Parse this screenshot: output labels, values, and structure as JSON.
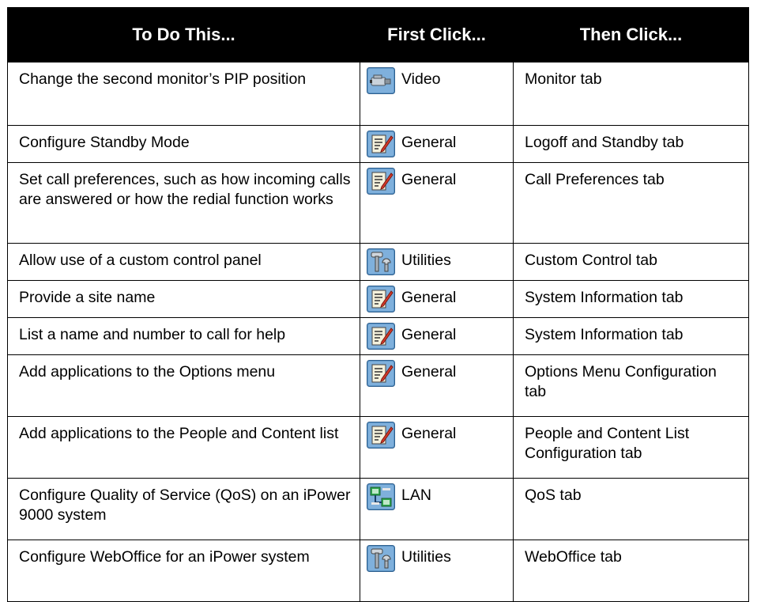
{
  "header": {
    "col1": "To Do This...",
    "col2": "First Click...",
    "col3": "Then Click..."
  },
  "rows": [
    {
      "task": "Change the second monitor’s PIP position",
      "first_icon": "video-camera-icon",
      "first_label": "Video",
      "then": "Monitor tab"
    },
    {
      "task": "Configure Standby Mode",
      "first_icon": "general-settings-icon",
      "first_label": "General",
      "then": "Logoff and Standby tab"
    },
    {
      "task": "Set call preferences, such as how incoming calls are answered or how the redial function works",
      "first_icon": "general-settings-icon",
      "first_label": "General",
      "then": "Call Preferences tab"
    },
    {
      "task": "Allow use of a custom control panel",
      "first_icon": "utilities-tools-icon",
      "first_label": "Utilities",
      "then": "Custom Control tab"
    },
    {
      "task": "Provide a site name",
      "first_icon": "general-settings-icon",
      "first_label": "General",
      "then": "System Information tab"
    },
    {
      "task": "List a name and number to call for help",
      "first_icon": "general-settings-icon",
      "first_label": "General",
      "then": "System Information tab"
    },
    {
      "task": "Add applications to the Options menu",
      "first_icon": "general-settings-icon",
      "first_label": "General",
      "then": "Options Menu Configuration tab"
    },
    {
      "task": "Add applications to the People and Content list",
      "first_icon": "general-settings-icon",
      "first_label": "General",
      "then": "People and Content List Configuration tab"
    },
    {
      "task": "Configure Quality of Service (QoS) on an iPower 9000 system",
      "first_icon": "lan-network-icon",
      "first_label": "LAN",
      "then": "QoS tab"
    },
    {
      "task": "Configure WebOffice for an iPower system",
      "first_icon": "utilities-tools-icon",
      "first_label": "Utilities",
      "then": "WebOffice tab"
    }
  ]
}
